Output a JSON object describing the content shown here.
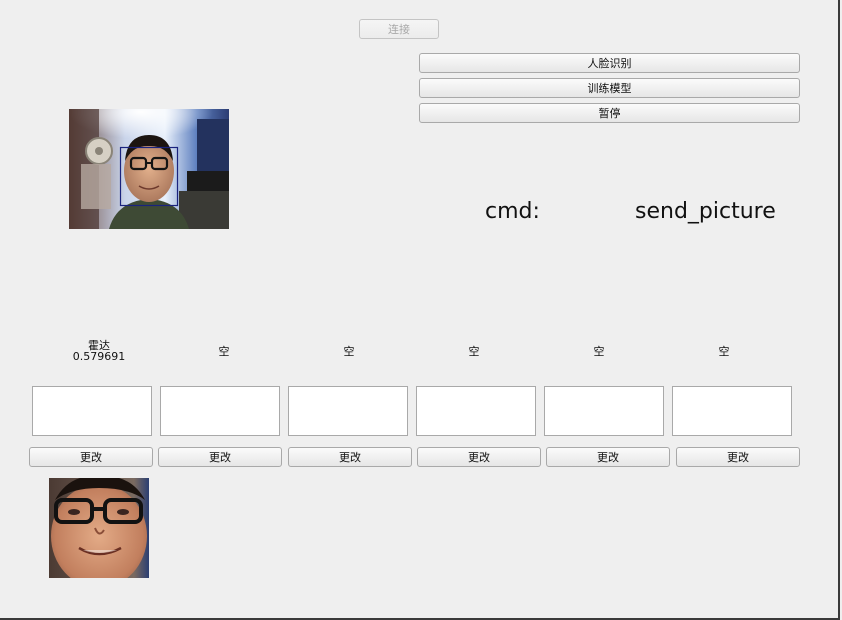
{
  "toolbar": {
    "connect_label": "连接",
    "recognize_label": "人脸识别",
    "train_label": "训练模型",
    "pause_label": "暂停"
  },
  "status": {
    "cmd_label": "cmd:",
    "cmd_value": "send_picture"
  },
  "slots": [
    {
      "name": "霍达",
      "score": "0.579691",
      "button_label": "更改"
    },
    {
      "name": "空",
      "score": "",
      "button_label": "更改"
    },
    {
      "name": "空",
      "score": "",
      "button_label": "更改"
    },
    {
      "name": "空",
      "score": "",
      "button_label": "更改"
    },
    {
      "name": "空",
      "score": "",
      "button_label": "更改"
    },
    {
      "name": "空",
      "score": "",
      "button_label": "更改"
    }
  ],
  "colors": {
    "face_box": "#1a237e",
    "window_bg": "#efefef"
  }
}
